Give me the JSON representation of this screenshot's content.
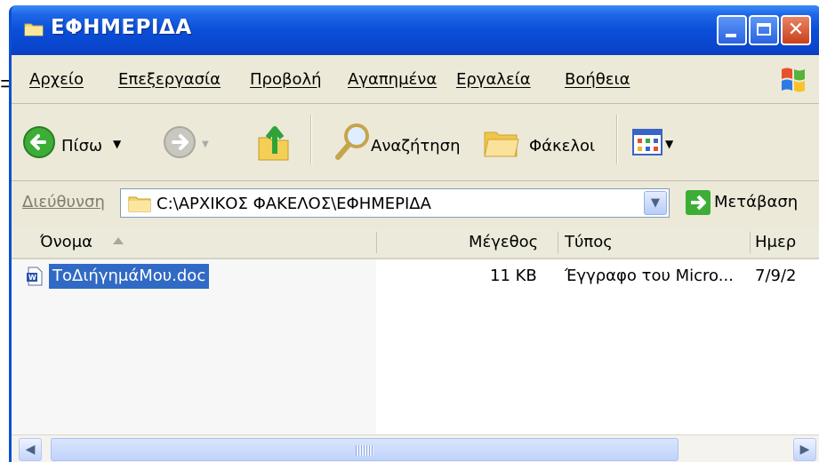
{
  "window": {
    "title": "ΕΦΗΜΕΡΙΔΑ",
    "controls": {
      "minimize": "_",
      "maximize": "□",
      "close": "✕"
    }
  },
  "menu": [
    {
      "label": "Αρχείο"
    },
    {
      "label": "Επεξεργασία"
    },
    {
      "label": "Προβολή"
    },
    {
      "label": "Αγαπημένα"
    },
    {
      "label": "Εργαλεία"
    },
    {
      "label": "Βοήθεια"
    }
  ],
  "toolbar": {
    "back_label": "Πίσω",
    "search_label": "Αναζήτηση",
    "folders_label": "Φάκελοι"
  },
  "address": {
    "label": "Διεύθυνση",
    "path": "C:\\ΑΡΧΙΚΟΣ ΦΑΚΕΛΟΣ\\ΕΦΗΜΕΡΙΔΑ",
    "go_label": "Μετάβαση"
  },
  "list": {
    "columns": [
      "Όνομα",
      "Μέγεθος",
      "Τύπος",
      "Ημερ"
    ],
    "sort": {
      "column": "Όνομα",
      "direction": "ascending"
    },
    "rows": [
      {
        "name": "ΤοΔιήγημάΜου.doc",
        "size": "11 KB",
        "type": "Έγγραφο του Micro...",
        "date": "7/9/2",
        "selected": true
      }
    ]
  },
  "colors": {
    "titlebar": "#0a4fd8",
    "selection": "#316ac5",
    "window_bg": "#ece9d8"
  }
}
